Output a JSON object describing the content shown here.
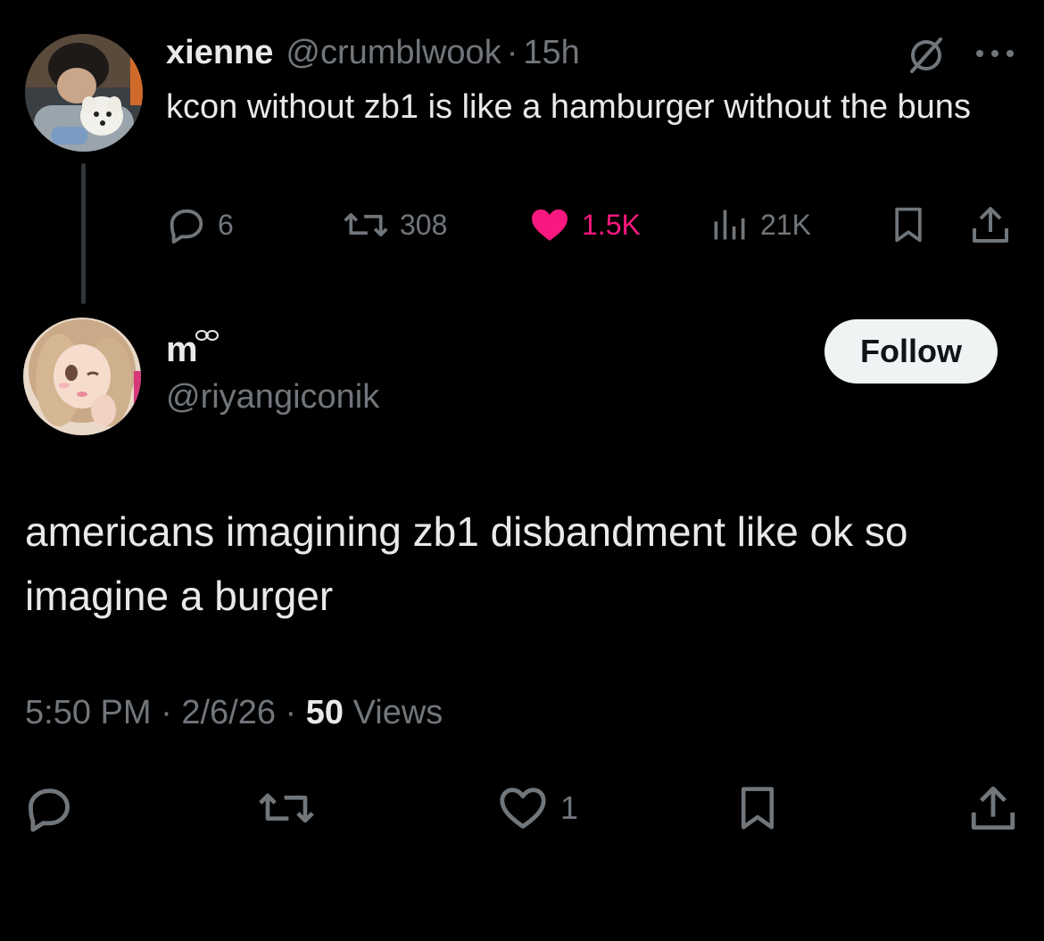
{
  "parent_tweet": {
    "display_name": "xienne",
    "handle": "@crumblwook",
    "separator": "·",
    "time": "15h",
    "text": "kcon without zb1 is like a hamburger without the buns",
    "stats": {
      "replies": "6",
      "retweets": "308",
      "likes": "1.5K",
      "views": "21K"
    }
  },
  "main_tweet": {
    "display_name": "m",
    "handle": "@riyangiconik",
    "follow_label": "Follow",
    "text": "americans imagining zb1 disbandment like ok so imagine a burger",
    "time": "5:50 PM",
    "separator": "·",
    "date": "2/6/26",
    "views_count": "50",
    "views_label": "Views",
    "likes": "1"
  },
  "icons": {
    "reply": "speech-bubble-icon",
    "retweet": "retweet-arrows-icon",
    "like": "heart-icon",
    "views": "bar-chart-icon",
    "bookmark": "bookmark-icon",
    "share": "share-upload-icon",
    "grok": "grok-slash-circle-icon",
    "more": "more-dots-icon"
  },
  "colors": {
    "background": "#000000",
    "text_primary": "#e7e9ea",
    "text_secondary": "#71767b",
    "like_active": "#f91880",
    "follow_bg": "#eff3f4",
    "follow_text": "#0f1419"
  }
}
